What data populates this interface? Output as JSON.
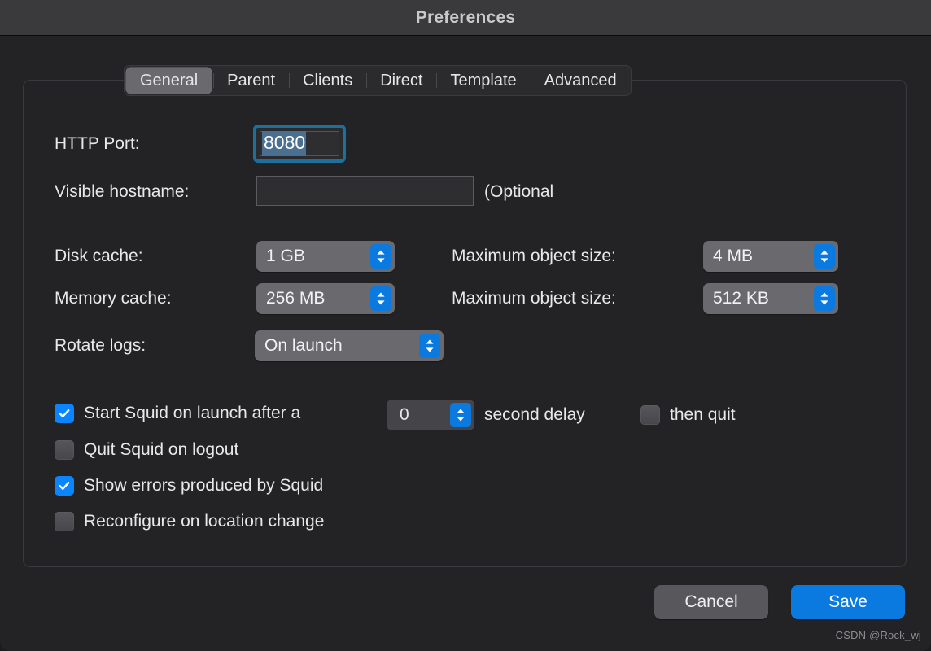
{
  "window": {
    "title": "Preferences"
  },
  "tabs": [
    {
      "label": "General",
      "selected": true
    },
    {
      "label": "Parent",
      "selected": false
    },
    {
      "label": "Clients",
      "selected": false
    },
    {
      "label": "Direct",
      "selected": false
    },
    {
      "label": "Template",
      "selected": false
    },
    {
      "label": "Advanced",
      "selected": false
    }
  ],
  "form": {
    "http_port": {
      "label": "HTTP Port:",
      "value": "8080",
      "selected": true,
      "focused": true
    },
    "visible_hostname": {
      "label": "Visible hostname:",
      "value": "",
      "placeholder": "",
      "hint": "(Optional"
    },
    "disk_cache": {
      "label": "Disk cache:",
      "value": "1 GB"
    },
    "disk_max_object_size": {
      "label": "Maximum object size:",
      "value": "4 MB"
    },
    "memory_cache": {
      "label": "Memory cache:",
      "value": "256 MB"
    },
    "memory_max_object_size": {
      "label": "Maximum object size:",
      "value": "512 KB"
    },
    "rotate_logs": {
      "label": "Rotate logs:",
      "value": "On launch"
    }
  },
  "options": {
    "start_on_launch": {
      "label": "Start Squid on launch after a",
      "checked": true,
      "delay_value": "0",
      "delay_suffix": "second delay"
    },
    "then_quit": {
      "label": "then quit",
      "checked": false
    },
    "quit_on_logout": {
      "label": "Quit Squid on logout",
      "checked": false
    },
    "show_errors": {
      "label": "Show errors produced by Squid",
      "checked": true
    },
    "reconfigure_on_location_change": {
      "label": "Reconfigure on location change",
      "checked": false
    }
  },
  "footer": {
    "cancel_label": "Cancel",
    "save_label": "Save"
  },
  "watermark": "CSDN @Rock_wj",
  "colors": {
    "accent_blue": "#0a84ff",
    "button_blue": "#0a7ae0",
    "focus_ring": "#1d6f9c",
    "selection": "#4b6f90",
    "titlebar": "#3a3a3c",
    "background": "#232326",
    "popup_gray": "#6a6a6e"
  }
}
